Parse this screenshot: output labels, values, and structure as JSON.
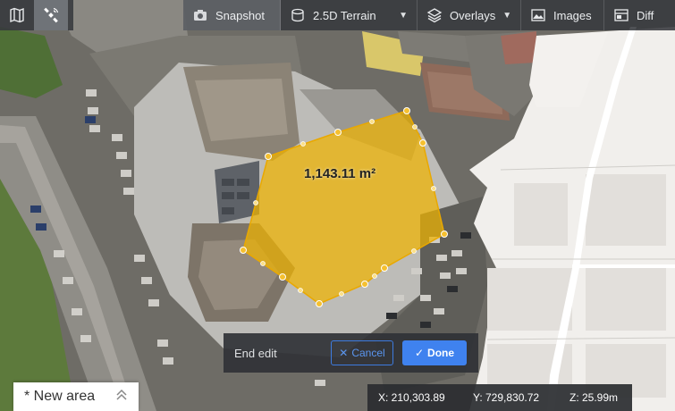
{
  "toolbar": {
    "snapshot_label": "Snapshot",
    "terrain_label": "2.5D Terrain",
    "overlays_label": "Overlays",
    "images_label": "Images",
    "diff_label": "Diff"
  },
  "measurement": {
    "area_label": "1,143.11 m²"
  },
  "edit_panel": {
    "title": "End edit",
    "cancel_label": "Cancel",
    "done_label": "Done"
  },
  "area_tab": {
    "label": "* New area"
  },
  "coordinates": {
    "x": "X: 210,303.89",
    "y": "Y: 729,830.72",
    "z": "Z: 25.99m"
  },
  "colors": {
    "polygon_fill": "#f0b400",
    "accent_blue": "#3f82ef",
    "toolbar_bg": "#37393d"
  }
}
